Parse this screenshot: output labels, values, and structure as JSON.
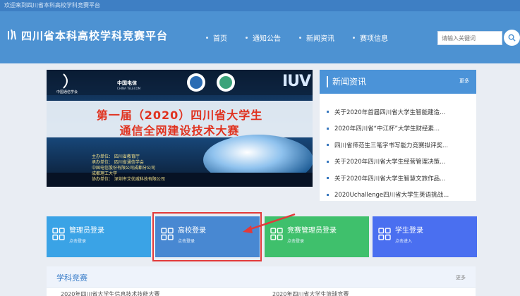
{
  "topbar": {
    "welcome": "欢迎来到四川省本科高校学科竞赛平台"
  },
  "header": {
    "title": "四川省本科高校学科竞赛平台",
    "nav": [
      "首页",
      "通知公告",
      "新闻资讯",
      "赛项信息"
    ],
    "search_placeholder": "请输入关键词"
  },
  "banner": {
    "org": "中国通信学会",
    "brand": "中国电信",
    "brand_en": "CHINA TELECOM",
    "iuv": "IUV",
    "headline_1": "第一届（2020）四川省大学生",
    "headline_2": "通信全网建设技术大赛",
    "organizers": [
      "主办单位： 四川省教育厅",
      "承办单位： 四川省通信学会",
      "中国电信股份有限公司成都分公司",
      "成都理工大学",
      "协办单位： 深圳市艾优威科技有限公司"
    ]
  },
  "news": {
    "title": "新闻资讯",
    "more": "更多",
    "items": [
      "关于2020年首届四川省大学生智能建造...",
      "2020年四川省“中江杯”大学生财经素...",
      "四川省师范生三笔字书写能力竞赛拟评奖...",
      "关于2020年四川省大学生经营管理决策...",
      "关于2020年四川省大学生智慧文旅作品...",
      "2020Uchallenge四川省大学生英语挑战..."
    ]
  },
  "tiles": [
    {
      "label": "管理员登录",
      "sub": "点击登录"
    },
    {
      "label": "高校登录",
      "sub": "点击登录"
    },
    {
      "label": "竞赛管理员登录",
      "sub": "点击登录"
    },
    {
      "label": "学生登录",
      "sub": "点击进入"
    }
  ],
  "subject": {
    "title": "学科竞赛",
    "more": "更多",
    "row_left": "2020年四川省大学生信息技术技能大赛",
    "row_right": "2020年四川省大学生篮球竞赛"
  },
  "colors": {
    "header": "#4d92d2",
    "admin_tile": "#3aa3e6",
    "school_tile": "#4888d2",
    "contest_tile": "#3fc06c",
    "student_tile": "#4a6ff0",
    "highlight": "#e23a3a"
  }
}
